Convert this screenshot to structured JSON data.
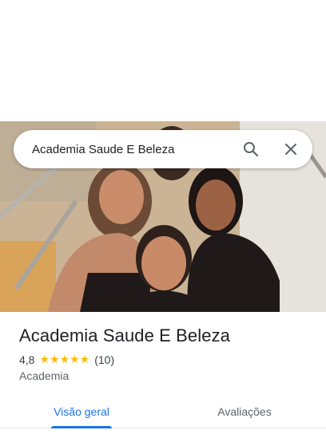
{
  "search": {
    "query": "Academia Saude E Beleza",
    "search_icon": "search-icon",
    "close_icon": "close-icon"
  },
  "place": {
    "name": "Academia Saude E Beleza",
    "rating": "4,8",
    "stars": "★★★★★",
    "star_level": 4.8,
    "review_count": "(10)",
    "category": "Academia"
  },
  "tabs": [
    {
      "label": "Visão geral",
      "active": true
    },
    {
      "label": "Avaliações",
      "active": false
    }
  ],
  "colors": {
    "accent": "#1a73e8",
    "star": "#fbbc04",
    "text": "#202124"
  }
}
